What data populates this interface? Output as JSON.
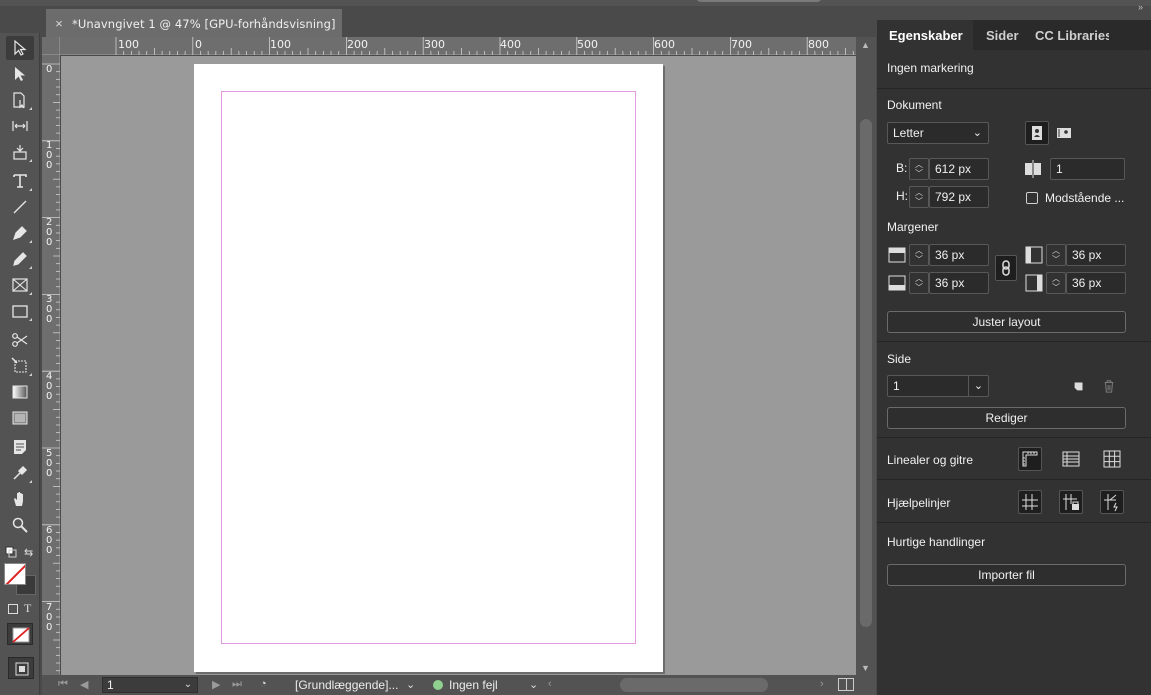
{
  "document_tab": {
    "close_icon": "×",
    "title": "*Unavngivet 1 @ 47% [GPU-forhåndsvisning]"
  },
  "ruler": {
    "h_labels": [
      "100",
      "0",
      "100",
      "200",
      "300",
      "400",
      "500",
      "600",
      "700",
      "800"
    ],
    "v_labels": [
      "0",
      "100",
      "200",
      "300",
      "400",
      "500",
      "600",
      "700"
    ]
  },
  "tools": [
    "selection-tool-icon",
    "direct-selection-tool-icon",
    "page-tool-icon",
    "gap-tool-icon",
    "content-collector-icon",
    "type-tool-icon",
    "line-tool-icon",
    "pen-tool-icon",
    "pencil-tool-icon",
    "rectangle-frame-tool-icon",
    "rectangle-tool-icon",
    "scissors-tool-icon",
    "free-transform-tool-icon",
    "gradient-swatch-tool-icon",
    "gradient-feather-tool-icon",
    "note-tool-icon",
    "eyedropper-tool-icon",
    "hand-tool-icon",
    "zoom-tool-icon"
  ],
  "status_bar": {
    "page_value": "1",
    "workspace": "[Grundlæggende]...",
    "preflight": "Ingen fejl",
    "ok_color": "#8fd18f"
  },
  "panel": {
    "tabs": [
      "Egenskaber",
      "Sider",
      "CC Libraries"
    ],
    "selection_text": "Ingen markering",
    "document": {
      "heading": "Dokument",
      "preset": "Letter",
      "width_label": "B:",
      "width_value": "612 px",
      "height_label": "H:",
      "height_value": "792 px",
      "pages_value": "1",
      "facing_pages_label": "Modstående ..."
    },
    "margins": {
      "heading": "Margener",
      "top": "36 px",
      "bottom": "36 px",
      "left": "36 px",
      "right": "36 px"
    },
    "adjust_layout_button": "Juster layout",
    "page": {
      "heading": "Side",
      "value": "1",
      "edit_button": "Rediger"
    },
    "rulers_grids_label": "Linealer og gitre",
    "guides_label": "Hjælpelinjer",
    "quick_actions": {
      "heading": "Hurtige handlinger",
      "import_button": "Importer fil"
    }
  },
  "colors": {
    "margin_guide": "#e59ae0",
    "panel_bg": "#323232",
    "canvas_bg": "#9a9a9a"
  }
}
